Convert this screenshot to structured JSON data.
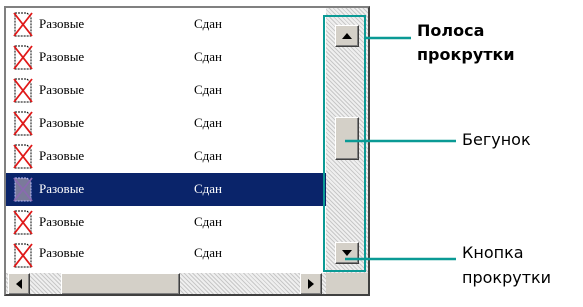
{
  "list": {
    "rows": [
      {
        "type": "Разовые",
        "status": "Сдан",
        "selected": false
      },
      {
        "type": "Разовые",
        "status": "Сдан",
        "selected": false
      },
      {
        "type": "Разовые",
        "status": "Сдан",
        "selected": false
      },
      {
        "type": "Разовые",
        "status": "Сдан",
        "selected": false
      },
      {
        "type": "Разовые",
        "status": "Сдан",
        "selected": false
      },
      {
        "type": "Разовые",
        "status": "Сдан",
        "selected": true
      },
      {
        "type": "Разовые",
        "status": "Сдан",
        "selected": false
      },
      {
        "type": "Разовые",
        "status": "Сдан",
        "selected": false
      }
    ],
    "row_icon": "crossed-document-icon"
  },
  "callouts": {
    "scrollbar_line1": "Полоса",
    "scrollbar_line2": "прокрутки",
    "thumb": "Бегунок",
    "button_line1": "Кнопка",
    "button_line2": "прокрутки"
  },
  "colors": {
    "selection": "#0a246a",
    "callout": "#0a9a95",
    "icon_red": "#e01818"
  }
}
